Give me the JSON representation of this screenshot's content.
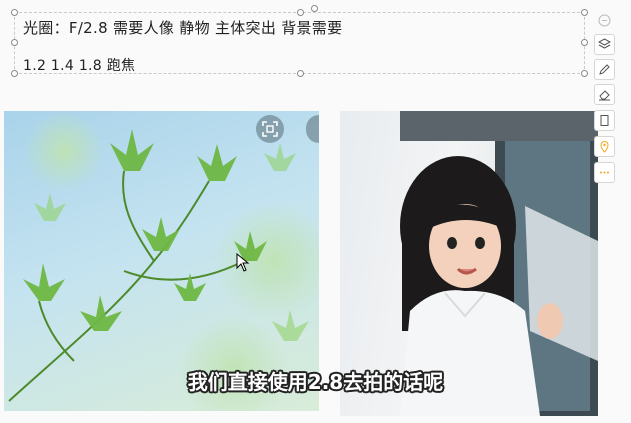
{
  "text_box": {
    "line1": "光圈：F/2.8   需要人像 静物   主体突出   背景需要",
    "line2": "1.2 1.4 1.8     跑焦"
  },
  "images": [
    {
      "name": "photo-leaves",
      "description_icon": "maple-leaves-photo"
    },
    {
      "name": "photo-girl",
      "description_icon": "child-portrait-photo"
    }
  ],
  "toolbar": {
    "icons": [
      "collapse-icon",
      "layers-icon",
      "pen-icon",
      "eraser-icon",
      "bookmark-icon",
      "location-pin-icon",
      "more-icon"
    ]
  },
  "subtitle": "我们直接使用2.8去拍的话呢",
  "colors": {
    "accent": "#f5a623",
    "leaf_green": "#6fb845",
    "sky_blue": "#a9d3ea"
  }
}
